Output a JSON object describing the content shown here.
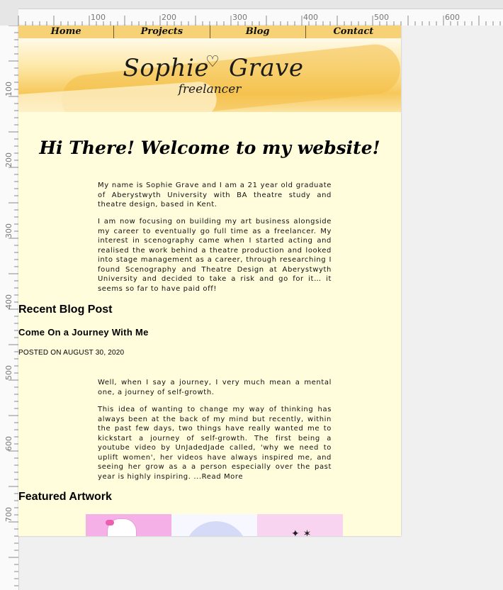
{
  "ruler": {
    "top_labels": [
      "100",
      "200",
      "300",
      "400",
      "500",
      "600"
    ],
    "left_labels": [
      "100",
      "200",
      "300",
      "400",
      "500",
      "600",
      "700"
    ]
  },
  "nav": {
    "items": [
      "Home",
      "Projects",
      "Blog",
      "Contact"
    ]
  },
  "banner": {
    "logo_name": "Sophie",
    "logo_name2": "Grave",
    "logo_sub": "freelancer"
  },
  "welcome": {
    "heading": "Hi There! Welcome to my website!",
    "para1": "My name is Sophie Grave and I am a 21 year old graduate of Aberystwyth University with BA theatre study and theatre design, based in Kent.",
    "para2": "I am now focusing on building my art business alongside my career to eventually go full time as a freelancer. My interest in scenography came when I started acting and realised the work behind a theatre production and looked into stage management as a career, through researching I found Scenography and Theatre Design at Aberystwyth University and decided to take a risk and go for it… it seems so far to have paid off!"
  },
  "blog": {
    "section_title": "Recent Blog Post",
    "post_title": "Come On a Journey With Me",
    "posted_on": "POSTED ON AUGUST 30, 2020",
    "para1": "Well, when I say a journey, I very much mean a mental one, a journey of self-growth.",
    "para2": "This idea of wanting to change my way of thinking has always been at the back of my mind but recently, within the past few days, two things have really wanted me to kickstart a journey of self-growth. The first being a youtube video by UnJadedJade called, 'why we need to uplift women', her videos have always inspired me, and seeing her grow as a a person especially over the past year is highly inspiring. ...Read More"
  },
  "featured": {
    "section_title": "Featured Artwork",
    "items": [
      {
        "icon": "cat-with-bow-icon"
      },
      {
        "icon": "circle-icon"
      },
      {
        "icon": "sparkle-icon"
      }
    ]
  },
  "colors": {
    "nav_bg": "#f7d176",
    "page_bg": "#fffddc",
    "banner_wash": "#f6c85a"
  }
}
